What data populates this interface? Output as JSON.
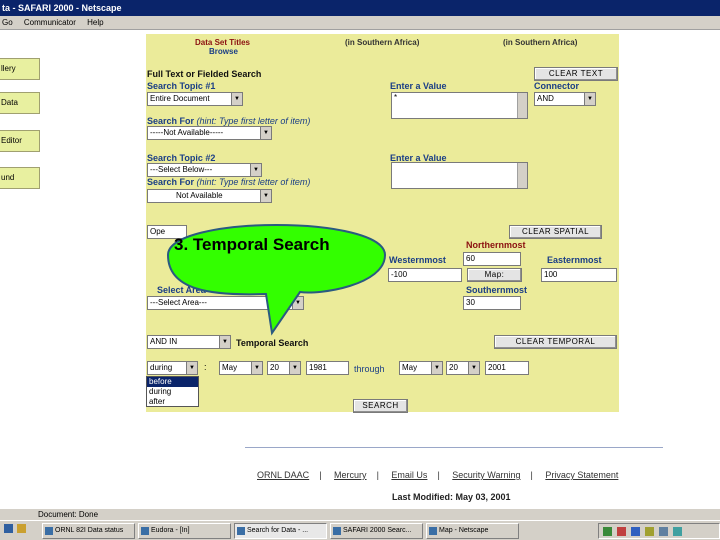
{
  "window": {
    "title": "ta - SAFARI 2000 - Netscape",
    "menu": [
      "Go",
      "Communicator",
      "Help"
    ]
  },
  "left_sidebar": {
    "items": [
      "llery",
      "Data",
      "Editor",
      "und"
    ]
  },
  "form": {
    "top_headers": {
      "data_set_titles": "Data Set Titles",
      "browse": "Browse",
      "southern_africa_1": "(in Southern Africa)",
      "southern_africa_2": "(in Southern Africa)"
    },
    "full_text_title": "Full Text or Fielded Search",
    "clear_text_button": "CLEAR TEXT",
    "search_topic_1_label": "Search Topic #1",
    "search_topic_1_value": "Entire Document",
    "enter_value_1_label": "Enter a Value",
    "enter_value_1_text": "*",
    "connector_label": "Connector",
    "connector_value": "AND",
    "search_for_1_label": "Search For",
    "search_for_1_hint": "(hint: Type first letter of item)",
    "search_for_1_value": "-----Not Available-----",
    "search_topic_2_label": "Search Topic #2",
    "search_topic_2_value": "---Select Below---",
    "enter_value_2_label": "Enter a Value",
    "search_for_2_label": "Search For",
    "search_for_2_hint": "(hint: Type first letter of item)",
    "search_for_2_value": "Not Available",
    "clear_spatial_button": "CLEAR SPATIAL",
    "spatial_select_value": "Ope",
    "northernmost_label": "Northernmost",
    "northernmost_value": "60",
    "westernmost_label": "Westernmost",
    "easternmost_label": "Easternmost",
    "westernmost_value": "-100",
    "map_button": "Map:",
    "easternmost_value": "100",
    "select_area_label": "Select Area",
    "select_area_value": "---Select Area---",
    "southernmost_label": "Southernmost",
    "southernmost_value": "30",
    "temporal_mode_value": "AND IN",
    "temporal_search_label": "Temporal Search",
    "clear_temporal_button": "CLEAR TEMPORAL",
    "temporal_op_value": "during",
    "colon": ":",
    "start_month": "May",
    "start_day": "20",
    "start_year": "1981",
    "through_label": "through",
    "end_month": "May",
    "end_day": "20",
    "end_year": "2001",
    "temporal_options": [
      "before",
      "during",
      "after"
    ],
    "search_button": "SEARCH"
  },
  "callout": {
    "text": "3.  Temporal Search"
  },
  "footer": {
    "links": [
      "ORNL DAAC",
      "Mercury",
      "Email Us",
      "Security Warning",
      "Privacy Statement"
    ],
    "last_modified": "Last Modified: May 03, 2001"
  },
  "status": {
    "text": "Document: Done"
  },
  "taskbar": {
    "tasks": [
      "ORNL 82I Data status",
      "Eudora - [In]",
      "Search for Data - ...",
      "SAFARI 2000 Searc...",
      "Map - Netscape"
    ],
    "active_task_index": 2
  }
}
